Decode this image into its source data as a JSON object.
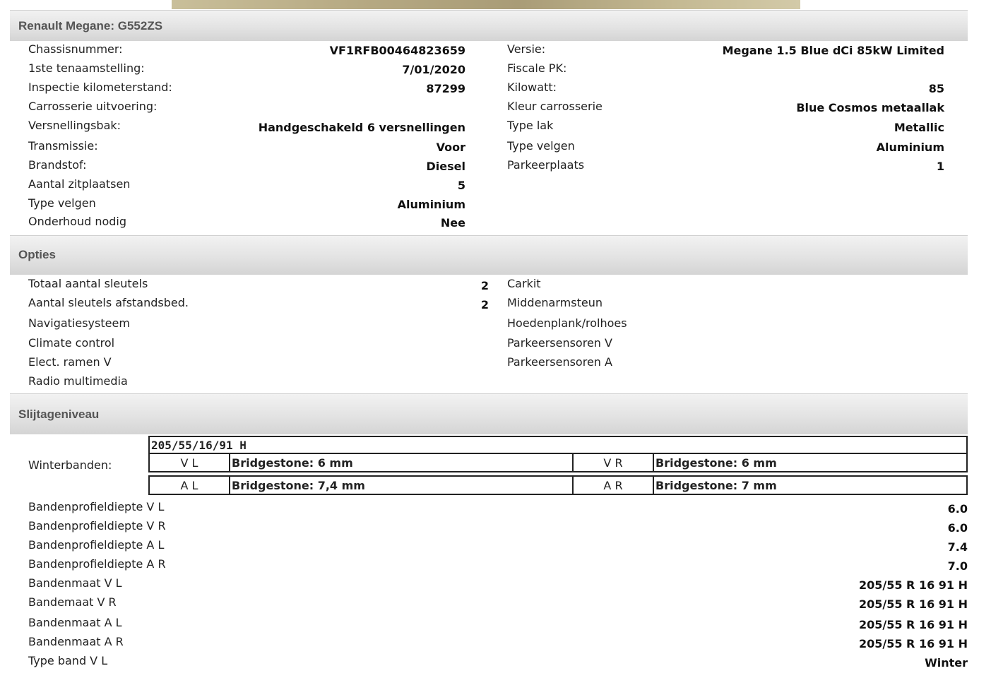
{
  "vehicle": {
    "title": "Renault Megane: G552ZS",
    "left": [
      {
        "label": "Chassisnummer:",
        "value": "VF1RFB00464823659"
      },
      {
        "label": "1ste tenaamstelling:",
        "value": "7/01/2020"
      },
      {
        "label": "Inspectie kilometerstand:",
        "value": "87299"
      },
      {
        "label": "Carrosserie uitvoering:",
        "value": ""
      },
      {
        "label": "Versnellingsbak:",
        "value": "Handgeschakeld 6 versnellingen"
      },
      {
        "label": "Transmissie:",
        "value": "Voor"
      },
      {
        "label": "Brandstof:",
        "value": "Diesel"
      },
      {
        "label": "Aantal zitplaatsen",
        "value": "5"
      },
      {
        "label": "Type velgen",
        "value": "Aluminium"
      },
      {
        "label": "Onderhoud nodig",
        "value": "Nee"
      }
    ],
    "right": [
      {
        "label": "Versie:",
        "value": "Megane 1.5 Blue dCi 85kW Limited"
      },
      {
        "label": "Fiscale PK:",
        "value": ""
      },
      {
        "label": "Kilowatt:",
        "value": "85"
      },
      {
        "label": "Kleur carrosserie",
        "value": "Blue Cosmos metaallak"
      },
      {
        "label": "Type lak",
        "value": "Metallic"
      },
      {
        "label": "Type velgen",
        "value": "Aluminium"
      },
      {
        "label": "Parkeerplaats",
        "value": "1"
      }
    ]
  },
  "options": {
    "title": "Opties",
    "left": [
      {
        "label": "Totaal aantal sleutels",
        "value": "2"
      },
      {
        "label": "Aantal sleutels afstandsbed.",
        "value": "2"
      },
      {
        "label": "Navigatiesysteem",
        "value": ""
      },
      {
        "label": "Climate control",
        "value": ""
      },
      {
        "label": "Elect. ramen V",
        "value": ""
      },
      {
        "label": "Radio multimedia",
        "value": ""
      }
    ],
    "right": [
      {
        "label": "Carkit"
      },
      {
        "label": "Middenarmsteun"
      },
      {
        "label": "Hoedenplank/rolhoes"
      },
      {
        "label": "Parkeersensoren V"
      },
      {
        "label": "Parkeersensoren A"
      }
    ]
  },
  "wear": {
    "title": "Slijtageniveau",
    "winter_label": "Winterbanden:",
    "tire_size": "205/55/16/91 H",
    "tires": {
      "vl": {
        "pos": "V L",
        "brand": "Bridgestone: 6 mm"
      },
      "vr": {
        "pos": "V R",
        "brand": "Bridgestone: 6 mm"
      },
      "al": {
        "pos": "A L",
        "brand": "Bridgestone: 7,4 mm"
      },
      "ar": {
        "pos": "A R",
        "brand": "Bridgestone: 7 mm"
      }
    },
    "rows": [
      {
        "label": "Bandenprofieldiepte V L",
        "value": "6.0"
      },
      {
        "label": "Bandenprofieldiepte V R",
        "value": "6.0"
      },
      {
        "label": "Bandenprofieldiepte A L",
        "value": "7.4"
      },
      {
        "label": "Bandenprofieldiepte A R",
        "value": "7.0"
      },
      {
        "label": "Bandenmaat V L",
        "value": "205/55 R 16 91 H"
      },
      {
        "label": "Bandemaat V R",
        "value": "205/55 R 16 91 H"
      },
      {
        "label": "Bandenmaat A L",
        "value": "205/55 R 16 91 H"
      },
      {
        "label": "Bandenmaat A R",
        "value": "205/55 R 16 91 H"
      },
      {
        "label": "Type band V L",
        "value": "Winter"
      }
    ]
  }
}
